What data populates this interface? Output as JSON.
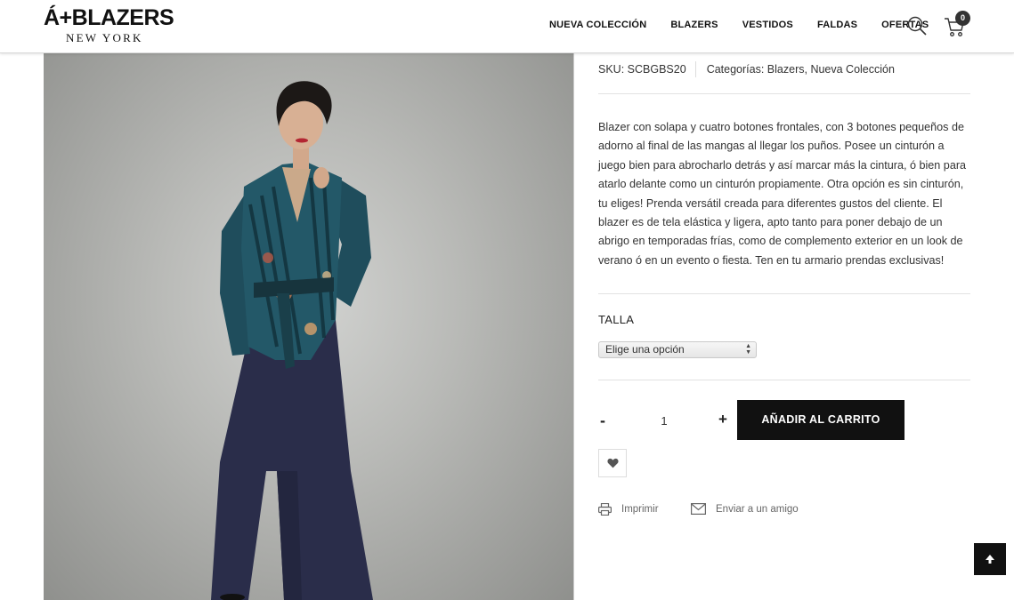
{
  "header": {
    "logo_main": "Á+BLAZERS",
    "logo_sub": "NEW YORK",
    "nav": [
      "NUEVA COLECCIÓN",
      "BLAZERS",
      "VESTIDOS",
      "FALDAS",
      "OFERTAS"
    ],
    "cart_count": "0",
    "icons": [
      "search-icon",
      "cart-icon"
    ]
  },
  "product": {
    "image_alt": "Blazer product photo",
    "sku_label": "SKU:",
    "sku": "SCBGBS20",
    "categories_label": "Categorías:",
    "categories": [
      "Blazers",
      "Nueva Colección"
    ],
    "description": "Blazer con solapa y cuatro botones frontales, con 3 botones pequeños de adorno al final de las mangas al llegar los puños. Posee un cinturón a juego bien para abrocharlo detrás y así marcar más la cintura, ó bien para atarlo delante como un cinturón propiamente. Otra opción es sin cinturón, tu eliges! Prenda versátil creada para diferentes gustos del cliente. El blazer es de tela elástica y ligera, apto tanto para poner debajo de un abrigo en temporadas frías, como de complemento exterior en un look de verano ó en un evento o fiesta. Ten en tu armario prendas exclusivas!",
    "size_label": "TALLA",
    "size_select": "Elige una opción",
    "qty_minus": "-",
    "qty": "1",
    "qty_plus": "+",
    "add_to_cart": "AÑADIR AL CARRITO"
  },
  "share": {
    "print": "Imprimir",
    "send_friend": "Enviar a un amigo"
  },
  "colors": {
    "accent": "#111111",
    "text": "#333333",
    "divider": "#e2e2e2"
  }
}
